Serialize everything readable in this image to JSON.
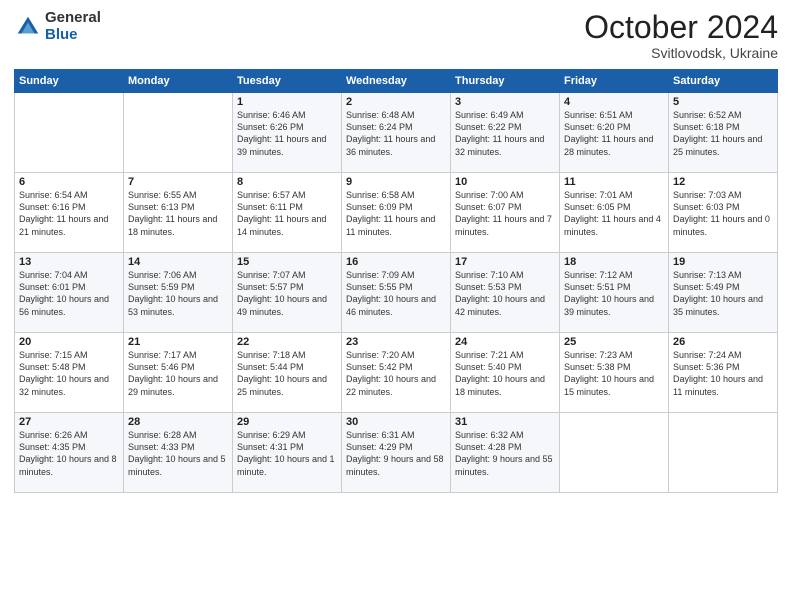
{
  "logo": {
    "general": "General",
    "blue": "Blue"
  },
  "title": "October 2024",
  "location": "Svitlovodsk, Ukraine",
  "days_of_week": [
    "Sunday",
    "Monday",
    "Tuesday",
    "Wednesday",
    "Thursday",
    "Friday",
    "Saturday"
  ],
  "weeks": [
    [
      {
        "num": "",
        "info": ""
      },
      {
        "num": "",
        "info": ""
      },
      {
        "num": "1",
        "info": "Sunrise: 6:46 AM\nSunset: 6:26 PM\nDaylight: 11 hours and 39 minutes."
      },
      {
        "num": "2",
        "info": "Sunrise: 6:48 AM\nSunset: 6:24 PM\nDaylight: 11 hours and 36 minutes."
      },
      {
        "num": "3",
        "info": "Sunrise: 6:49 AM\nSunset: 6:22 PM\nDaylight: 11 hours and 32 minutes."
      },
      {
        "num": "4",
        "info": "Sunrise: 6:51 AM\nSunset: 6:20 PM\nDaylight: 11 hours and 28 minutes."
      },
      {
        "num": "5",
        "info": "Sunrise: 6:52 AM\nSunset: 6:18 PM\nDaylight: 11 hours and 25 minutes."
      }
    ],
    [
      {
        "num": "6",
        "info": "Sunrise: 6:54 AM\nSunset: 6:16 PM\nDaylight: 11 hours and 21 minutes."
      },
      {
        "num": "7",
        "info": "Sunrise: 6:55 AM\nSunset: 6:13 PM\nDaylight: 11 hours and 18 minutes."
      },
      {
        "num": "8",
        "info": "Sunrise: 6:57 AM\nSunset: 6:11 PM\nDaylight: 11 hours and 14 minutes."
      },
      {
        "num": "9",
        "info": "Sunrise: 6:58 AM\nSunset: 6:09 PM\nDaylight: 11 hours and 11 minutes."
      },
      {
        "num": "10",
        "info": "Sunrise: 7:00 AM\nSunset: 6:07 PM\nDaylight: 11 hours and 7 minutes."
      },
      {
        "num": "11",
        "info": "Sunrise: 7:01 AM\nSunset: 6:05 PM\nDaylight: 11 hours and 4 minutes."
      },
      {
        "num": "12",
        "info": "Sunrise: 7:03 AM\nSunset: 6:03 PM\nDaylight: 11 hours and 0 minutes."
      }
    ],
    [
      {
        "num": "13",
        "info": "Sunrise: 7:04 AM\nSunset: 6:01 PM\nDaylight: 10 hours and 56 minutes."
      },
      {
        "num": "14",
        "info": "Sunrise: 7:06 AM\nSunset: 5:59 PM\nDaylight: 10 hours and 53 minutes."
      },
      {
        "num": "15",
        "info": "Sunrise: 7:07 AM\nSunset: 5:57 PM\nDaylight: 10 hours and 49 minutes."
      },
      {
        "num": "16",
        "info": "Sunrise: 7:09 AM\nSunset: 5:55 PM\nDaylight: 10 hours and 46 minutes."
      },
      {
        "num": "17",
        "info": "Sunrise: 7:10 AM\nSunset: 5:53 PM\nDaylight: 10 hours and 42 minutes."
      },
      {
        "num": "18",
        "info": "Sunrise: 7:12 AM\nSunset: 5:51 PM\nDaylight: 10 hours and 39 minutes."
      },
      {
        "num": "19",
        "info": "Sunrise: 7:13 AM\nSunset: 5:49 PM\nDaylight: 10 hours and 35 minutes."
      }
    ],
    [
      {
        "num": "20",
        "info": "Sunrise: 7:15 AM\nSunset: 5:48 PM\nDaylight: 10 hours and 32 minutes."
      },
      {
        "num": "21",
        "info": "Sunrise: 7:17 AM\nSunset: 5:46 PM\nDaylight: 10 hours and 29 minutes."
      },
      {
        "num": "22",
        "info": "Sunrise: 7:18 AM\nSunset: 5:44 PM\nDaylight: 10 hours and 25 minutes."
      },
      {
        "num": "23",
        "info": "Sunrise: 7:20 AM\nSunset: 5:42 PM\nDaylight: 10 hours and 22 minutes."
      },
      {
        "num": "24",
        "info": "Sunrise: 7:21 AM\nSunset: 5:40 PM\nDaylight: 10 hours and 18 minutes."
      },
      {
        "num": "25",
        "info": "Sunrise: 7:23 AM\nSunset: 5:38 PM\nDaylight: 10 hours and 15 minutes."
      },
      {
        "num": "26",
        "info": "Sunrise: 7:24 AM\nSunset: 5:36 PM\nDaylight: 10 hours and 11 minutes."
      }
    ],
    [
      {
        "num": "27",
        "info": "Sunrise: 6:26 AM\nSunset: 4:35 PM\nDaylight: 10 hours and 8 minutes."
      },
      {
        "num": "28",
        "info": "Sunrise: 6:28 AM\nSunset: 4:33 PM\nDaylight: 10 hours and 5 minutes."
      },
      {
        "num": "29",
        "info": "Sunrise: 6:29 AM\nSunset: 4:31 PM\nDaylight: 10 hours and 1 minute."
      },
      {
        "num": "30",
        "info": "Sunrise: 6:31 AM\nSunset: 4:29 PM\nDaylight: 9 hours and 58 minutes."
      },
      {
        "num": "31",
        "info": "Sunrise: 6:32 AM\nSunset: 4:28 PM\nDaylight: 9 hours and 55 minutes."
      },
      {
        "num": "",
        "info": ""
      },
      {
        "num": "",
        "info": ""
      }
    ]
  ]
}
